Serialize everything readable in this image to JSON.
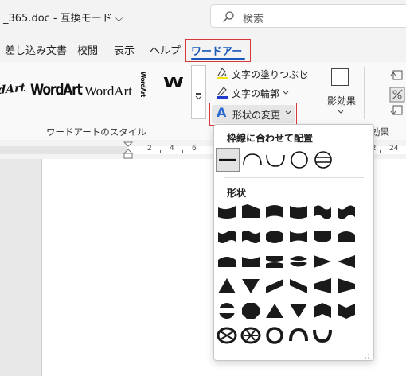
{
  "window": {
    "doc_title": "_365.doc  -  互換モード",
    "search_placeholder": "検索"
  },
  "tabs": [
    {
      "label": "差し込み文書"
    },
    {
      "label": "校閲"
    },
    {
      "label": "表示"
    },
    {
      "label": "ヘルプ"
    },
    {
      "label": "ワードアート",
      "active": true
    }
  ],
  "ribbon": {
    "wordart_samples": [
      "WordArt",
      "WordArt",
      "WordArt",
      "WordArt"
    ],
    "wordart_group_label": "ワードアートのスタイル",
    "fill_label": "文字の塗りつぶし",
    "outline_label": "文字の輪郭",
    "shape_change_label": "形状の変更",
    "shadow_label": "影効果",
    "effects_label": "効果"
  },
  "ruler": {
    "numbers": [
      "2",
      "4",
      "6",
      "16",
      "18",
      "20",
      "22",
      "24"
    ]
  },
  "dropdown": {
    "path_heading": "枠線に合わせて配置",
    "warp_heading": "形状",
    "path_options": [
      "line",
      "arch-up",
      "arch-down",
      "circle",
      "button"
    ],
    "selected_path": "line"
  },
  "colors": {
    "accent": "#1a58b8",
    "highlight": "#d93838",
    "fill_swatch": "#f5e400",
    "outline_swatch": "#1f3ccf"
  }
}
